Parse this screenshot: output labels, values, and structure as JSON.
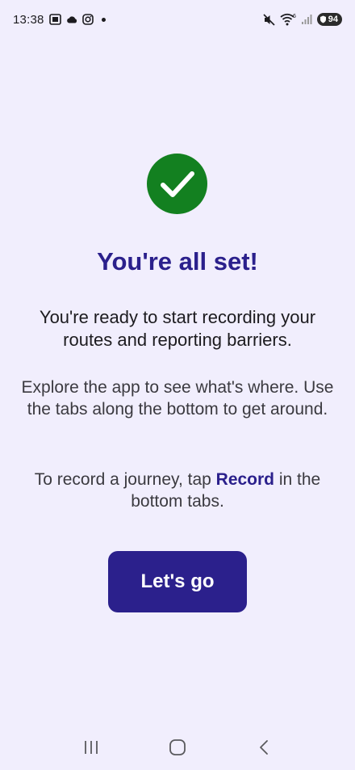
{
  "status_bar": {
    "time": "13:38",
    "battery": "94",
    "signal_label": "6",
    "left_icons": [
      "screenshot-icon",
      "cloud-icon",
      "instagram-icon",
      "notification-dot"
    ],
    "right_icons": [
      "mute-icon",
      "wifi-icon",
      "signal-icon",
      "battery-icon"
    ]
  },
  "main": {
    "success_icon": "check-icon",
    "title": "You're all set!",
    "paragraph_1": "You're ready to start recording your routes and reporting barriers.",
    "paragraph_2": "Explore the app to see what's where. Use the tabs along the bottom to get around.",
    "paragraph_3_before": "To record a journey, tap ",
    "paragraph_3_bold": "Record",
    "paragraph_3_after": " in the bottom tabs.",
    "cta_label": "Let's go"
  },
  "navigation": {
    "icons": [
      "recents-icon",
      "home-icon",
      "back-icon"
    ]
  },
  "colors": {
    "background": "#f1eefd",
    "accent": "#2b208c",
    "success": "#138020"
  }
}
